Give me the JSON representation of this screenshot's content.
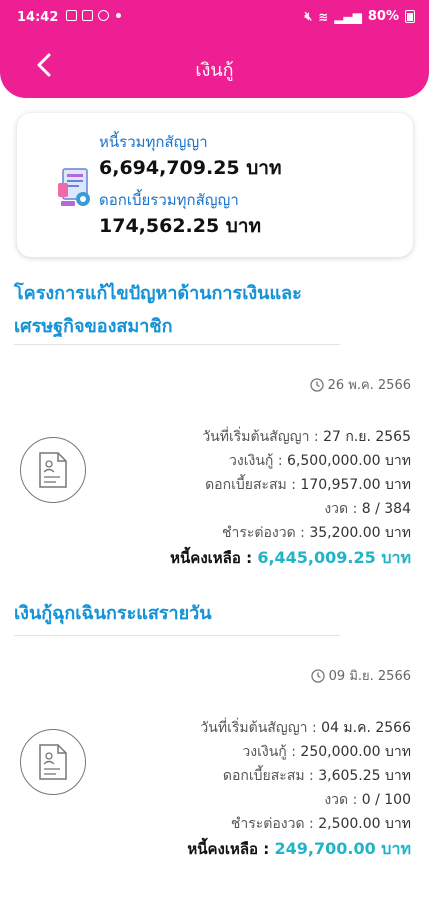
{
  "status_bar": {
    "time": "14:42",
    "battery": "80%"
  },
  "header": {
    "title": "เงินกู้"
  },
  "summary": {
    "total_debt_label": "หนี้รวมทุกสัญญา",
    "total_debt_value": "6,694,709.25 บาท",
    "total_interest_label": "ดอกเบี้ยรวมทุกสัญญา",
    "total_interest_value": "174,562.25 บาท"
  },
  "contracts": [
    {
      "title_line1": "โครงการแก้ไขปัญหาด้านการเงินและ",
      "title_line2": "เศรษฐกิจของสมาชิก",
      "date": "26 พ.ค. 2566",
      "rows": [
        {
          "label": "วันที่เริ่มต้นสัญญา :",
          "value": "27 ก.ย. 2565"
        },
        {
          "label": "วงเงินกู้ :",
          "value": "6,500,000.00 บาท"
        },
        {
          "label": "ดอกเบี้ยสะสม :",
          "value": "170,957.00 บาท"
        },
        {
          "label": "งวด :",
          "value": "8 / 384"
        },
        {
          "label": "ชำระต่องวด :",
          "value": "35,200.00 บาท"
        }
      ],
      "remaining_label": "หนี้คงเหลือ :",
      "remaining_value": "6,445,009.25 บาท"
    },
    {
      "title_line1": "เงินกู้ฉุกเฉินกระแสรายวัน",
      "title_line2": "",
      "date": "09 มิ.ย. 2566",
      "rows": [
        {
          "label": "วันที่เริ่มต้นสัญญา :",
          "value": "04 ม.ค. 2566"
        },
        {
          "label": "วงเงินกู้ :",
          "value": "250,000.00 บาท"
        },
        {
          "label": "ดอกเบี้ยสะสม :",
          "value": "3,605.25 บาท"
        },
        {
          "label": "งวด :",
          "value": "0 / 100"
        },
        {
          "label": "ชำระต่องวด :",
          "value": "2,500.00 บาท"
        }
      ],
      "remaining_label": "หนี้คงเหลือ :",
      "remaining_value": "249,700.00 บาท"
    }
  ],
  "colors": {
    "header": "#ee1f93",
    "accent_blue": "#1593d6",
    "remaining_teal": "#21b4c9"
  },
  "icons": [
    "back-chevron-icon",
    "clock-icon",
    "document-icon",
    "finance-illustration-icon"
  ]
}
